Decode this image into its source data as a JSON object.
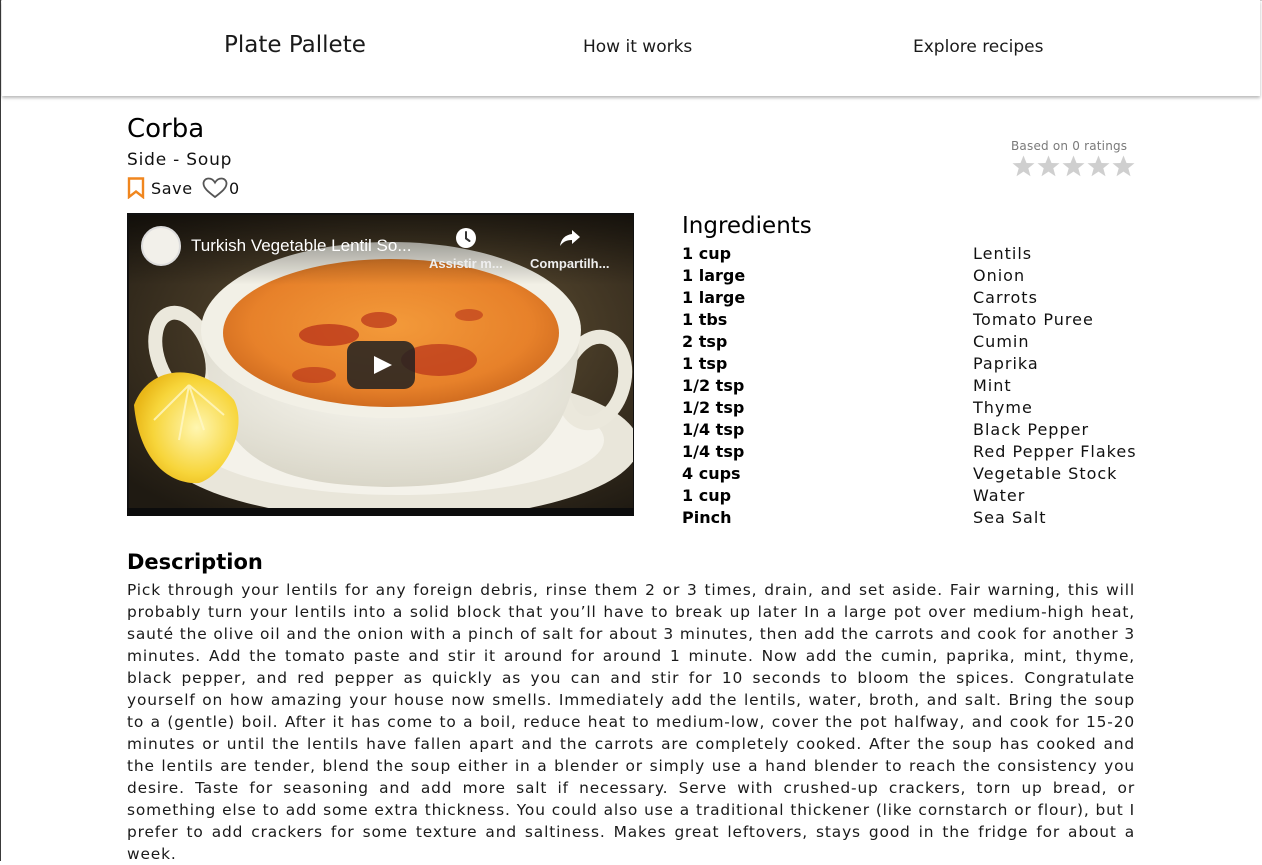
{
  "nav": {
    "brand": "Plate Pallete",
    "how_it_works": "How it works",
    "explore_recipes": "Explore recipes"
  },
  "recipe": {
    "title": "Corba",
    "category": "Side - Soup",
    "save_label": "Save",
    "likes": "0",
    "rating_text": "Based on 0 ratings",
    "star_count": 5,
    "rating_value": 0
  },
  "video": {
    "title": "Turkish Vegetable Lentil So...",
    "watch_later": "Assistir m...",
    "share": "Compartilh..."
  },
  "ingredients": {
    "title": "Ingredients",
    "items": [
      {
        "qty": "1 cup",
        "name": "Lentils"
      },
      {
        "qty": "1 large",
        "name": "Onion"
      },
      {
        "qty": "1 large",
        "name": "Carrots"
      },
      {
        "qty": "1 tbs",
        "name": "Tomato Puree"
      },
      {
        "qty": "2 tsp",
        "name": "Cumin"
      },
      {
        "qty": "1 tsp",
        "name": "Paprika"
      },
      {
        "qty": "1/2 tsp",
        "name": "Mint"
      },
      {
        "qty": "1/2 tsp",
        "name": "Thyme"
      },
      {
        "qty": "1/4 tsp",
        "name": "Black Pepper"
      },
      {
        "qty": "1/4 tsp",
        "name": "Red Pepper Flakes"
      },
      {
        "qty": "4 cups",
        "name": "Vegetable Stock"
      },
      {
        "qty": "1 cup",
        "name": "Water"
      },
      {
        "qty": "Pinch",
        "name": "Sea Salt"
      }
    ]
  },
  "description": {
    "title": "Description",
    "text": "Pick through your lentils for any foreign debris, rinse them 2 or 3 times, drain, and set aside. Fair warning, this will probably turn your lentils into a solid block that you’ll have to break up later In a large pot over medium-high heat, sauté the olive oil and the onion with a pinch of salt for about 3 minutes, then add the carrots and cook for another 3 minutes. Add the tomato paste and stir it around for around 1 minute. Now add the cumin, paprika, mint, thyme, black pepper, and red pepper as quickly as you can and stir for 10 seconds to bloom the spices. Congratulate yourself on how amazing your house now smells. Immediately add the lentils, water, broth, and salt. Bring the soup to a (gentle) boil. After it has come to a boil, reduce heat to medium-low, cover the pot halfway, and cook for 15-20 minutes or until the lentils have fallen apart and the carrots are completely cooked. After the soup has cooked and the lentils are tender, blend the soup either in a blender or simply use a hand blender to reach the consistency you desire. Taste for seasoning and add more salt if necessary. Serve with crushed-up crackers, torn up bread, or something else to add some extra thickness. You could also use a traditional thickener (like cornstarch or flour), but I prefer to add crackers for some texture and saltiness. Makes great leftovers, stays good in the fridge for about a week."
  },
  "colors": {
    "save_icon": "#f0861e",
    "star_empty": "#cfcfcf",
    "heart_outline": "#555555",
    "play_button": "#212121"
  }
}
